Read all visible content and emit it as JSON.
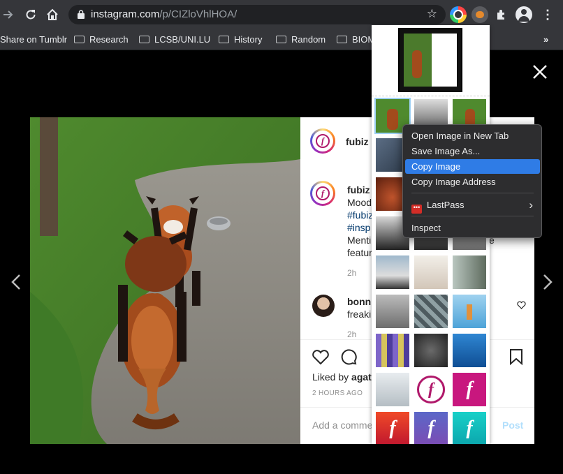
{
  "browser": {
    "url_host": "instagram.com",
    "url_path": "/p/CIZloVhlHOA/",
    "bookmarks": [
      {
        "label": "Share on Tumblr",
        "folder": false
      },
      {
        "label": "Research",
        "folder": true
      },
      {
        "label": "LCSB/UNI.LU",
        "folder": true
      },
      {
        "label": "History",
        "folder": true
      },
      {
        "label": "Random",
        "folder": true
      },
      {
        "label": "BIOM",
        "folder": true
      }
    ],
    "overflow_label": "»"
  },
  "post": {
    "account": "fubiz",
    "caption_lines": [
      "fubiz",
      "Mood",
      "#fubiz",
      "#insp",
      "Menti",
      "featur"
    ],
    "caption_age": "2h",
    "comment_user": "bonn",
    "comment_text": "freaki",
    "comment_age": "2h",
    "liked_by": "Liked by",
    "liked_user": "agat",
    "timestamp": "2 HOURS AGO",
    "add_comment_placeholder": "Add a comme",
    "post_label": "Post",
    "partial_e": "e"
  },
  "context_menu": {
    "items": [
      {
        "label": "Open Image in New Tab"
      },
      {
        "label": "Save Image As..."
      },
      {
        "label": "Copy Image",
        "highlighted": true
      },
      {
        "label": "Copy Image Address"
      },
      {
        "label": "LastPass",
        "submenu_arrow": "›"
      },
      {
        "label": "Inspect"
      }
    ]
  },
  "colors": {
    "chrome_bg": "#35363a",
    "menu_highlight": "#2f7ce6",
    "instagram_link": "#00376b",
    "post_button": "#b2dffc"
  }
}
